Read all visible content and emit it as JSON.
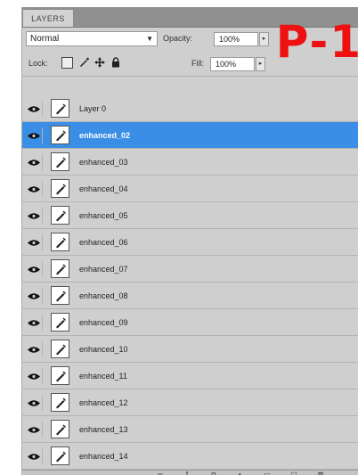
{
  "panel": {
    "tab_label": "LAYERS",
    "blend_mode": "Normal",
    "opacity_label": "Opacity:",
    "opacity_value": "100%",
    "lock_label": "Lock:",
    "fill_label": "Fill:",
    "fill_value": "100%"
  },
  "watermark": "P-1",
  "layers": [
    {
      "name": "Layer 0",
      "selected": false
    },
    {
      "name": "enhanced_02",
      "selected": true
    },
    {
      "name": "enhanced_03",
      "selected": false
    },
    {
      "name": "enhanced_04",
      "selected": false
    },
    {
      "name": "enhanced_05",
      "selected": false
    },
    {
      "name": "enhanced_06",
      "selected": false
    },
    {
      "name": "enhanced_07",
      "selected": false
    },
    {
      "name": "enhanced_08",
      "selected": false
    },
    {
      "name": "enhanced_09",
      "selected": false
    },
    {
      "name": "enhanced_10",
      "selected": false
    },
    {
      "name": "enhanced_11",
      "selected": false
    },
    {
      "name": "enhanced_12",
      "selected": false
    },
    {
      "name": "enhanced_13",
      "selected": false
    },
    {
      "name": "enhanced_14",
      "selected": false
    }
  ],
  "colors": {
    "selection": "#3a8ee6",
    "watermark": "#ee1111"
  },
  "icons": {
    "visibility": "eye-icon",
    "thumbnail": "brush-icon",
    "lock_transparent": "checkerboard-icon",
    "lock_image": "brush-icon",
    "lock_position": "move-icon",
    "lock_all": "padlock-icon"
  }
}
